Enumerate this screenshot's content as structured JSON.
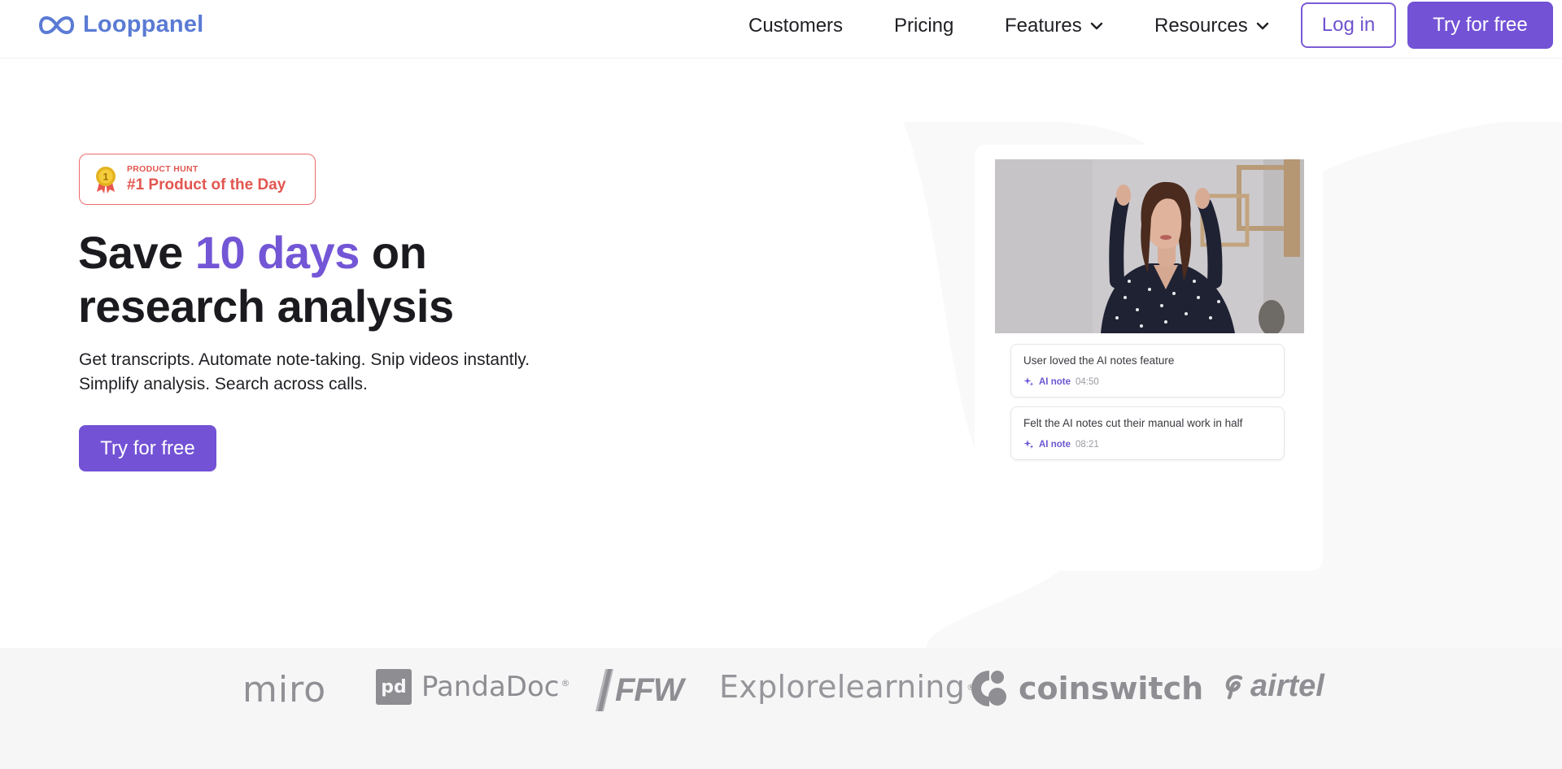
{
  "nav": {
    "brand": "Looppanel",
    "links": [
      {
        "label": "Customers"
      },
      {
        "label": "Pricing"
      },
      {
        "label": "Features"
      },
      {
        "label": "Resources"
      }
    ],
    "login_label": "Log in",
    "cta_label": "Try for free"
  },
  "hero": {
    "badge": {
      "small": "PRODUCT HUNT",
      "big": "#1 Product of the Day",
      "medal_number": "1"
    },
    "headline": {
      "pre": "Save ",
      "accent": "10 days",
      "post": " on",
      "line2": "research analysis"
    },
    "subtext_line1": "Get transcripts. Automate note-taking. Snip videos instantly.",
    "subtext_line2": "Simplify analysis. Search across calls.",
    "cta_label": "Try for free"
  },
  "demo": {
    "notes": [
      {
        "text": "User loved the AI notes feature",
        "tag": "AI note",
        "time": "04:50"
      },
      {
        "text": "Felt the AI notes cut their manual work in half",
        "tag": "AI note",
        "time": "08:21"
      }
    ]
  },
  "logos": {
    "miro": "miro",
    "pandadoc_mark": "pd",
    "pandadoc": "PandaDoc",
    "pandadoc_reg": "®",
    "ffw": "FFW",
    "explore": "Explorelearning",
    "explore_reg": "®",
    "coinswitch": "coinswitch",
    "airtel": "airtel"
  },
  "colors": {
    "accent": "#7352d5",
    "brand_blue": "#5a7bd4",
    "product_hunt": "#e2564f",
    "logo_gray": "#8e8e93"
  },
  "icons": {
    "logo": "infinity-icon",
    "nav_dropdown": "chevron-down-icon",
    "badge": "medal-icon",
    "note_tag": "sparkle-icon"
  }
}
